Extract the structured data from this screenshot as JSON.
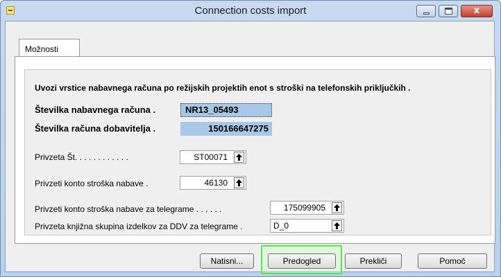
{
  "window": {
    "title": "Connection costs import",
    "close_glyph": "x"
  },
  "tabs": [
    {
      "label": "Možnosti"
    }
  ],
  "form": {
    "heading": "Uvozi vrstice nabavnega računa po režijskih projektih enot s stroški na telefonskih priključkih .",
    "invoice_no": {
      "label": "Številka nabavnega računa .",
      "value": "NR13_05493"
    },
    "vendor_invoice_no": {
      "label": "Številka računa dobavitelja .",
      "value": "150166647275"
    },
    "default_no": {
      "label": "Privzeta Št. . . . . . . . . . . .",
      "value": "ST00071"
    },
    "cost_account": {
      "label": "Privzeti konto stroška nabave .",
      "value": "46130"
    },
    "cost_account_telegram": {
      "label": "Privzeti konto stroška nabave za telegrame . . . . . .",
      "value": "175099905"
    },
    "vat_group_telegram": {
      "label": "Privzeta knjižna skupina izdelkov za DDV za telegrame .",
      "value": "D_0"
    }
  },
  "buttons": {
    "print": "Natisni...",
    "preview": "Predogled",
    "cancel": "Prekliči",
    "help": "Pomoč"
  },
  "colors": {
    "highlight": "#54e84a",
    "readonly_field": "#a8c8e8",
    "titlebar": "#c6daf0"
  },
  "icons": {
    "lookup": "arrow-up-icon",
    "app": "app-icon"
  }
}
